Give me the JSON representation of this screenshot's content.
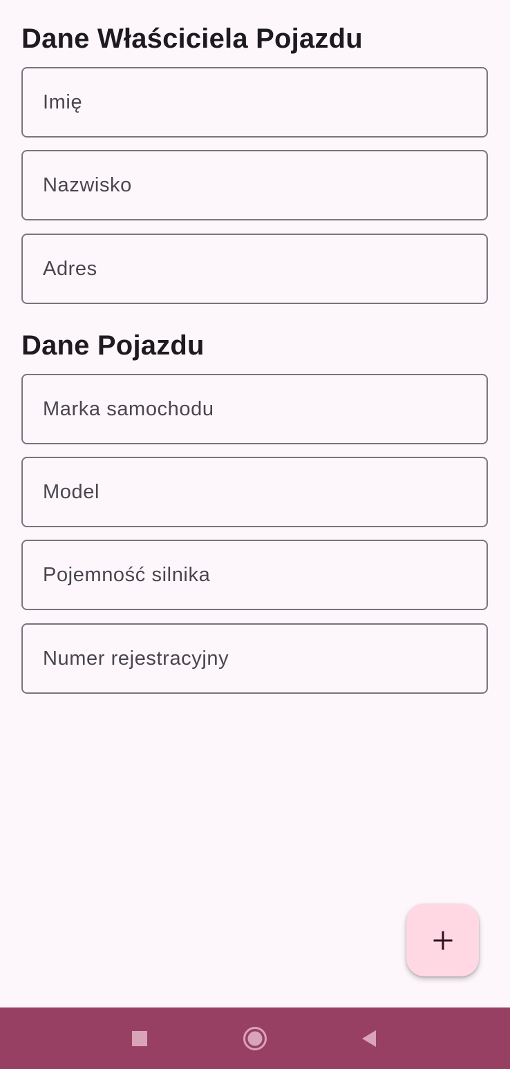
{
  "sections": {
    "owner_title": "Dane Właściciela Pojazdu",
    "vehicle_title": "Dane Pojazdu"
  },
  "fields": [
    {
      "placeholder": "Imię",
      "value": ""
    },
    {
      "placeholder": "Nazwisko",
      "value": ""
    },
    {
      "placeholder": "Adres",
      "value": ""
    },
    {
      "placeholder": "Marka samochodu",
      "value": ""
    },
    {
      "placeholder": "Model",
      "value": ""
    },
    {
      "placeholder": "Pojemność silnika",
      "value": ""
    },
    {
      "placeholder": "Numer rejestracyjny",
      "value": ""
    }
  ],
  "fab": {
    "icon": "plus-icon"
  },
  "navigation_bar": {
    "buttons": [
      {
        "icon": "recents-square-icon"
      },
      {
        "icon": "home-circle-icon"
      },
      {
        "icon": "back-triangle-icon"
      }
    ]
  },
  "colors": {
    "background": "#fdf7fb",
    "field_outline": "#79747e",
    "placeholder_text": "#49454f",
    "fab_container": "#ffd8e4",
    "fab_icon": "#31111d",
    "navigation_bar": "#984063"
  }
}
